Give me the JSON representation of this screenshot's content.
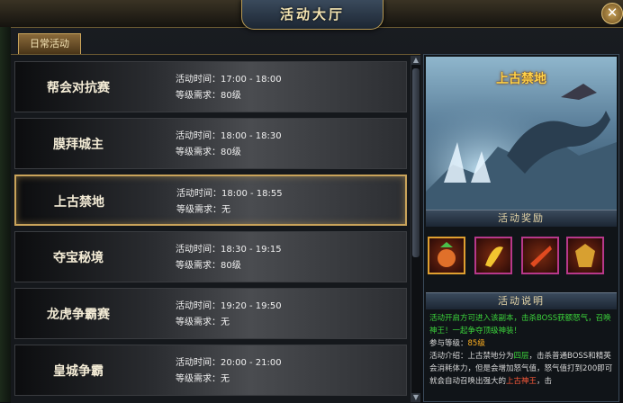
{
  "window": {
    "title": "活动大厅",
    "close": "✕"
  },
  "tabs": [
    {
      "label": "日常活动"
    }
  ],
  "activities": [
    {
      "name": "帮会对抗赛",
      "time": "活动时间：17:00 - 18:00",
      "level": "等级需求：80级",
      "selected": false
    },
    {
      "name": "膜拜城主",
      "time": "活动时间：18:00 - 18:30",
      "level": "等级需求：80级",
      "selected": false
    },
    {
      "name": "上古禁地",
      "time": "活动时间：18:00 - 18:55",
      "level": "等级需求：无",
      "selected": true
    },
    {
      "name": "夺宝秘境",
      "time": "活动时间：18:30 - 19:15",
      "level": "等级需求：80级",
      "selected": false
    },
    {
      "name": "龙虎争霸赛",
      "time": "活动时间：19:20 - 19:50",
      "level": "等级需求：无",
      "selected": false
    },
    {
      "name": "皇城争霸",
      "time": "活动时间：20:00 - 21:00",
      "level": "等级需求：无",
      "selected": false
    }
  ],
  "detail": {
    "title": "上古禁地",
    "rewards_header": "活动奖励",
    "desc_header": "活动说明",
    "desc_green": "活动开启方可进入该副本，击杀BOSS获额怒气，召唤神王！一起争夺顶级神装！",
    "desc_level_label": "参与等级：",
    "desc_level_value": "85级",
    "desc_intro_a": "活动介绍：上古禁地分为",
    "desc_intro_b": "四层",
    "desc_intro_c": "，击杀普通BOSS和精英会消耗体力，但是会增加怒气值，怒气值打到200即可就会自动召唤出强大的",
    "desc_intro_d": "上古神王",
    "desc_intro_e": "，击"
  },
  "colors": {
    "accent": "#c9a35a",
    "highlight_text": "#ffd24a",
    "green_text": "#3bd43b"
  },
  "icons": [
    "close-icon",
    "scroll-up-icon",
    "scroll-down-icon",
    "reward-item-icon"
  ]
}
